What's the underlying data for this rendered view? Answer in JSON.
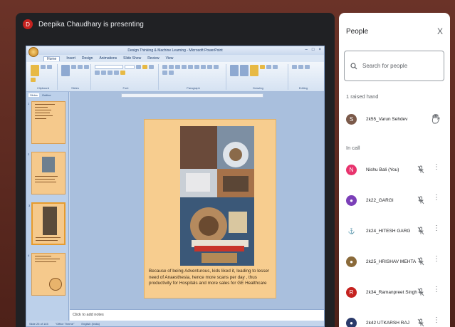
{
  "presentation": {
    "presenter_initial": "D",
    "presenter_text": "Deepika Chaudhary is presenting"
  },
  "ppt": {
    "window_title": "Design Thinking & Machine Learning - Microsoft PowerPoint",
    "tabs": [
      "Home",
      "Insert",
      "Design",
      "Animations",
      "Slide Show",
      "Review",
      "View"
    ],
    "ribbon_groups": [
      "Clipboard",
      "Slides",
      "Font",
      "Paragraph",
      "Drawing",
      "Editing"
    ],
    "pane_tabs": [
      "Slides",
      "Outline"
    ],
    "thumbnail_numbers": [
      "1",
      "2",
      "3",
      "4"
    ],
    "slide_caption": "Because of being Adventurous, kids liked it, leading to lesser need of Anaesthesia, hence more scans per day , thus productivity for Hospitals and more sales for GE Healthcare",
    "notes_placeholder": "Click to add notes",
    "status": [
      "Slide 25 of 145",
      "\"Office Theme\"",
      "English (India)"
    ]
  },
  "people": {
    "title": "People",
    "close_label": "X",
    "search_placeholder": "Search for people",
    "raised_hand_label": "1 raised hand",
    "raised": [
      {
        "initial": "S",
        "name": "2k55_Varun Sehdev",
        "color": "#7b5a4a"
      }
    ],
    "in_call_label": "In call",
    "participants": [
      {
        "initial": "N",
        "name": "Nishu Bali (You)",
        "color": "#e8336d"
      },
      {
        "initial": "●",
        "name": "2k22_GARGI",
        "color": "#7b3fb8"
      },
      {
        "initial": "⚓",
        "name": "2k24_HITESH GARG",
        "color": "#ffffff"
      },
      {
        "initial": "●",
        "name": "2k25_HRISHAV MEHTA",
        "color": "#8a6a3a"
      },
      {
        "initial": "R",
        "name": "2k34_Ramanpreet Singh",
        "color": "#c5221f"
      },
      {
        "initial": "●",
        "name": "2k42 UTKARSH RAJ",
        "color": "#2a3a6a"
      }
    ]
  }
}
